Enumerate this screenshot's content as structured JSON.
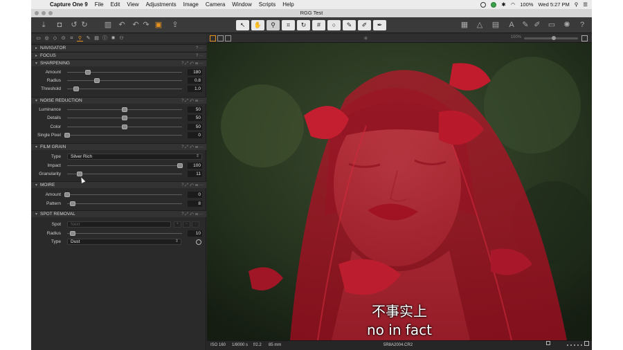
{
  "menubar": {
    "app_name": "Capture One 9",
    "items": [
      "File",
      "Edit",
      "View",
      "Adjustments",
      "Image",
      "Camera",
      "Window",
      "Scripts",
      "Help"
    ],
    "battery": "100%",
    "clock": "Wed 5:27 PM"
  },
  "window": {
    "title": "RGG Test"
  },
  "sections": {
    "navigator": "NAVIGATOR",
    "focus": "FOCUS",
    "sharpening": {
      "title": "SHARPENING",
      "amount": {
        "label": "Amount",
        "value": "180",
        "pos": 0.18
      },
      "radius": {
        "label": "Radius",
        "value": "0.8",
        "pos": 0.26
      },
      "threshold": {
        "label": "Threshold",
        "value": "1.0",
        "pos": 0.08
      }
    },
    "noise_reduction": {
      "title": "NOISE REDUCTION",
      "luminance": {
        "label": "Luminance",
        "value": "50",
        "pos": 0.5
      },
      "details": {
        "label": "Details",
        "value": "50",
        "pos": 0.5
      },
      "color": {
        "label": "Color",
        "value": "50",
        "pos": 0.5
      },
      "single_pixel": {
        "label": "Single Pixel",
        "value": "0",
        "pos": 0.0
      }
    },
    "film_grain": {
      "title": "FILM GRAIN",
      "type": {
        "label": "Type",
        "value": "Silver Rich"
      },
      "impact": {
        "label": "Impact",
        "value": "100",
        "pos": 0.98
      },
      "granularity": {
        "label": "Granularity",
        "value": "11",
        "pos": 0.11
      }
    },
    "moire": {
      "title": "MOIRE",
      "amount": {
        "label": "Amount",
        "value": "0",
        "pos": 0.0
      },
      "pattern": {
        "label": "Pattern",
        "value": "8",
        "pos": 0.05
      }
    },
    "spot_removal": {
      "title": "SPOT REMOVAL",
      "spot": {
        "label": "Spot",
        "value": "Next"
      },
      "radius": {
        "label": "Radius",
        "value": "10",
        "pos": 0.05
      },
      "type": {
        "label": "Type",
        "value": "Dust"
      }
    }
  },
  "viewer": {
    "zoom": "100%",
    "subtitle_cn": "不事实上",
    "subtitle_en": "no in fact",
    "iso": "ISO 160",
    "shutter": "1/8000 s",
    "aperture": "f/2.2",
    "focal": "85 mm",
    "filename": "5R8A2004.CR2"
  },
  "colors": {
    "accent": "#e8921f",
    "panel": "#2a2a2a",
    "veil": "#b5182a"
  },
  "icons": {
    "toolbar_left": [
      "import-icon",
      "camera-icon",
      "rotate-left-icon",
      "rotate-right-icon",
      "trash-icon",
      "undo-icon",
      "redo-icon",
      "reset-icon",
      "export-icon"
    ],
    "toolbar_center": [
      "select-cursor-icon",
      "pan-hand-icon",
      "zoom-icon",
      "crop-icon",
      "rotate-icon",
      "keystone-icon",
      "spot-icon",
      "brush-icon",
      "picker-icon",
      "wb-picker-icon"
    ],
    "toolbar_right": [
      "grid-icon",
      "warning-icon",
      "calendar-icon",
      "text-icon",
      "edit-icon",
      "copy-icon",
      "print-icon",
      "gear-icon",
      "help-icon"
    ]
  }
}
